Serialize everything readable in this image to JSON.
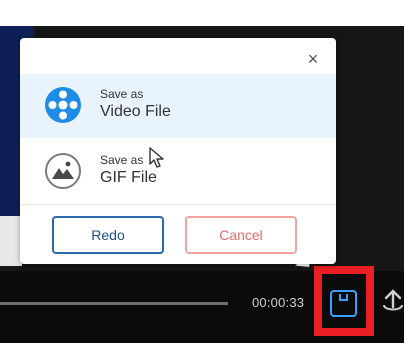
{
  "top_text": "                                      ",
  "dialog": {
    "close_label": "×",
    "options": [
      {
        "line1": "Save as",
        "line2": "Video File",
        "icon": "film-reel-icon",
        "color": "#1e8be6"
      },
      {
        "line1": "Save as",
        "line2": "GIF File",
        "icon": "gif-image-icon",
        "color": "#555555"
      }
    ],
    "buttons": {
      "redo": "Redo",
      "cancel": "Cancel"
    }
  },
  "player": {
    "timecode": "00:00:33"
  },
  "colors": {
    "highlight": "#ea1f25",
    "accent": "#1e8be6"
  }
}
